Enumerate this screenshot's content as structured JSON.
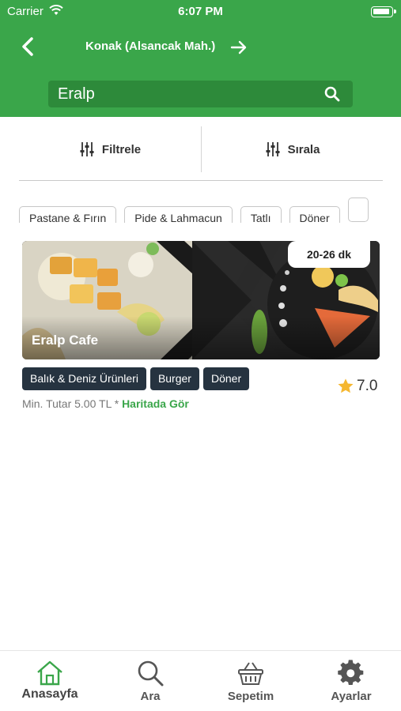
{
  "status_bar": {
    "carrier": "Carrier",
    "time": "6:07 PM"
  },
  "header": {
    "location": "Konak (Alsancak Mah.)"
  },
  "search": {
    "value": "Eralp",
    "placeholder": ""
  },
  "tools": {
    "filter_label": "Filtrele",
    "sort_label": "Sırala"
  },
  "categories": [
    "Pastane & Fırın",
    "Pide & Lahmacun",
    "Tatlı",
    "Döner",
    ""
  ],
  "restaurant": {
    "name": "Eralp Cafe",
    "delivery_time": "20-26 dk",
    "tags": [
      "Balık & Deniz Ürünleri",
      "Burger",
      "Döner"
    ],
    "rating": "7.0",
    "min_order": "Min. Tutar 5.00 TL *",
    "map_link": "Haritada Gör"
  },
  "tabbar": {
    "items": [
      {
        "label": "Anasayfa",
        "icon": "home-icon",
        "active": true
      },
      {
        "label": "Ara",
        "icon": "search-icon"
      },
      {
        "label": "Sepetim",
        "icon": "basket-icon"
      },
      {
        "label": "Ayarlar",
        "icon": "gear-icon"
      }
    ]
  },
  "colors": {
    "brand": "#3aa64a",
    "brand_dark": "#2d8a3a",
    "tag_bg": "#263340",
    "star": "#f5b730"
  }
}
